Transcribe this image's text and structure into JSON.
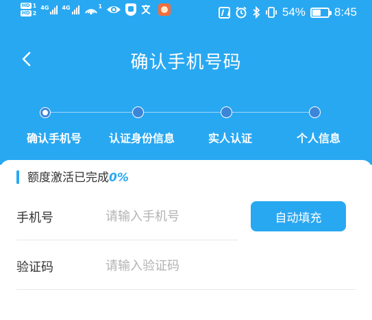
{
  "status_bar": {
    "hd1": "HD",
    "hd1_num": "1",
    "hd2": "HD",
    "hd2_num": "2",
    "sim1_network": "4G",
    "sim2_network": "4G",
    "hotspot_count": "1",
    "battery_percent": "54%",
    "battery_level": 0.54,
    "time": "8:45",
    "icons": [
      "hd-icon",
      "signal-icon",
      "hotspot-icon",
      "eye-icon",
      "shield-icon",
      "translate-icon",
      "app-badge-icon",
      "nfc-icon",
      "alarm-icon",
      "bluetooth-icon",
      "vibrate-icon",
      "battery-icon"
    ]
  },
  "nav": {
    "title": "确认手机号码",
    "back_icon": "chevron-left-icon"
  },
  "steps": [
    {
      "label": "确认手机号",
      "active": true
    },
    {
      "label": "认证身份信息",
      "active": false
    },
    {
      "label": "实人认证",
      "active": false
    },
    {
      "label": "个人信息",
      "active": false
    }
  ],
  "progress": {
    "prefix": "额度激活已完成",
    "percent": "0%"
  },
  "form": {
    "phone_label": "手机号",
    "phone_placeholder": "请输入手机号",
    "phone_value": "",
    "auto_fill_label": "自动填充",
    "code_label": "验证码",
    "code_placeholder": "请输入验证码",
    "code_value": ""
  },
  "colors": {
    "primary": "#29a8f2",
    "step_dot": "#3b86d9",
    "text": "#333333",
    "placeholder": "#b3b3b3"
  }
}
